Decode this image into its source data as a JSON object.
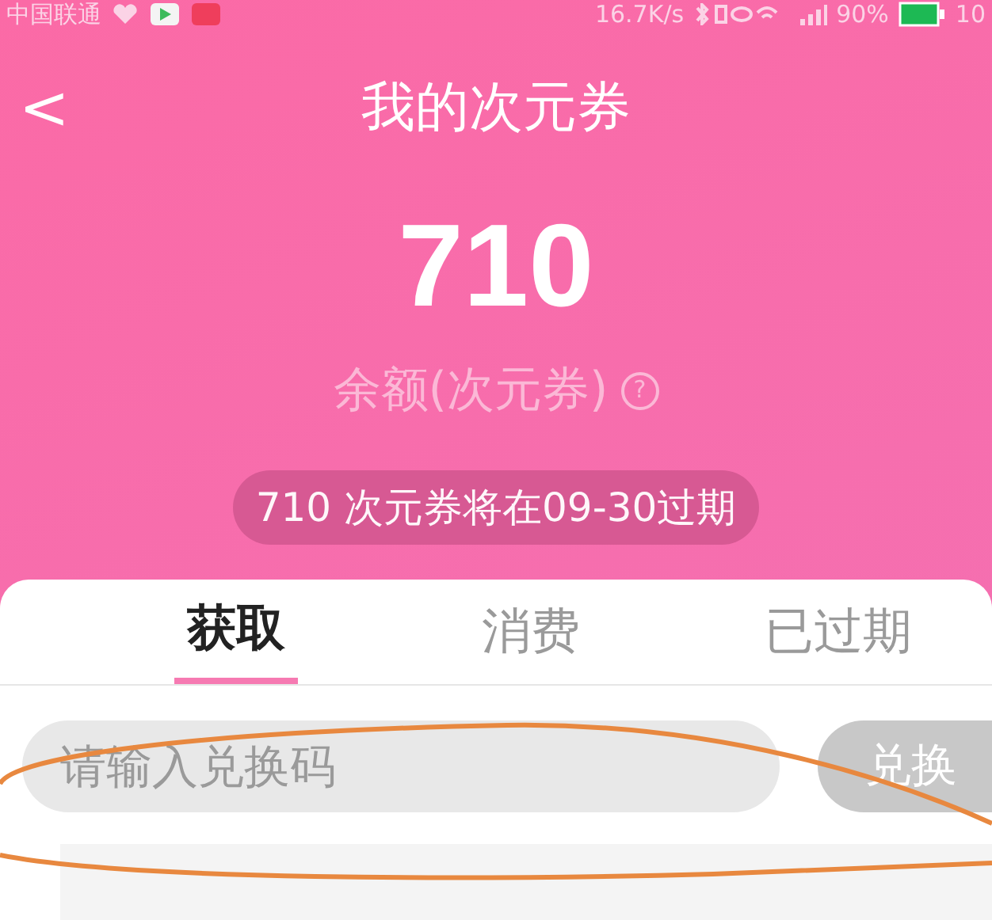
{
  "status_bar": {
    "carrier": "中国联通",
    "speed": "16.7K/s",
    "battery": "90%",
    "time": "10"
  },
  "header": {
    "back": "<",
    "title": "我的次元券"
  },
  "balance": {
    "amount": "710",
    "label": "余额(次元券)",
    "help": "?"
  },
  "notice": "710 次元券将在09-30过期",
  "tabs": [
    {
      "label": "获取",
      "selected": true
    },
    {
      "label": "消费",
      "selected": false
    },
    {
      "label": "已过期",
      "selected": false
    }
  ],
  "redeem": {
    "placeholder": "请输入兑换码",
    "button": "兑换"
  }
}
